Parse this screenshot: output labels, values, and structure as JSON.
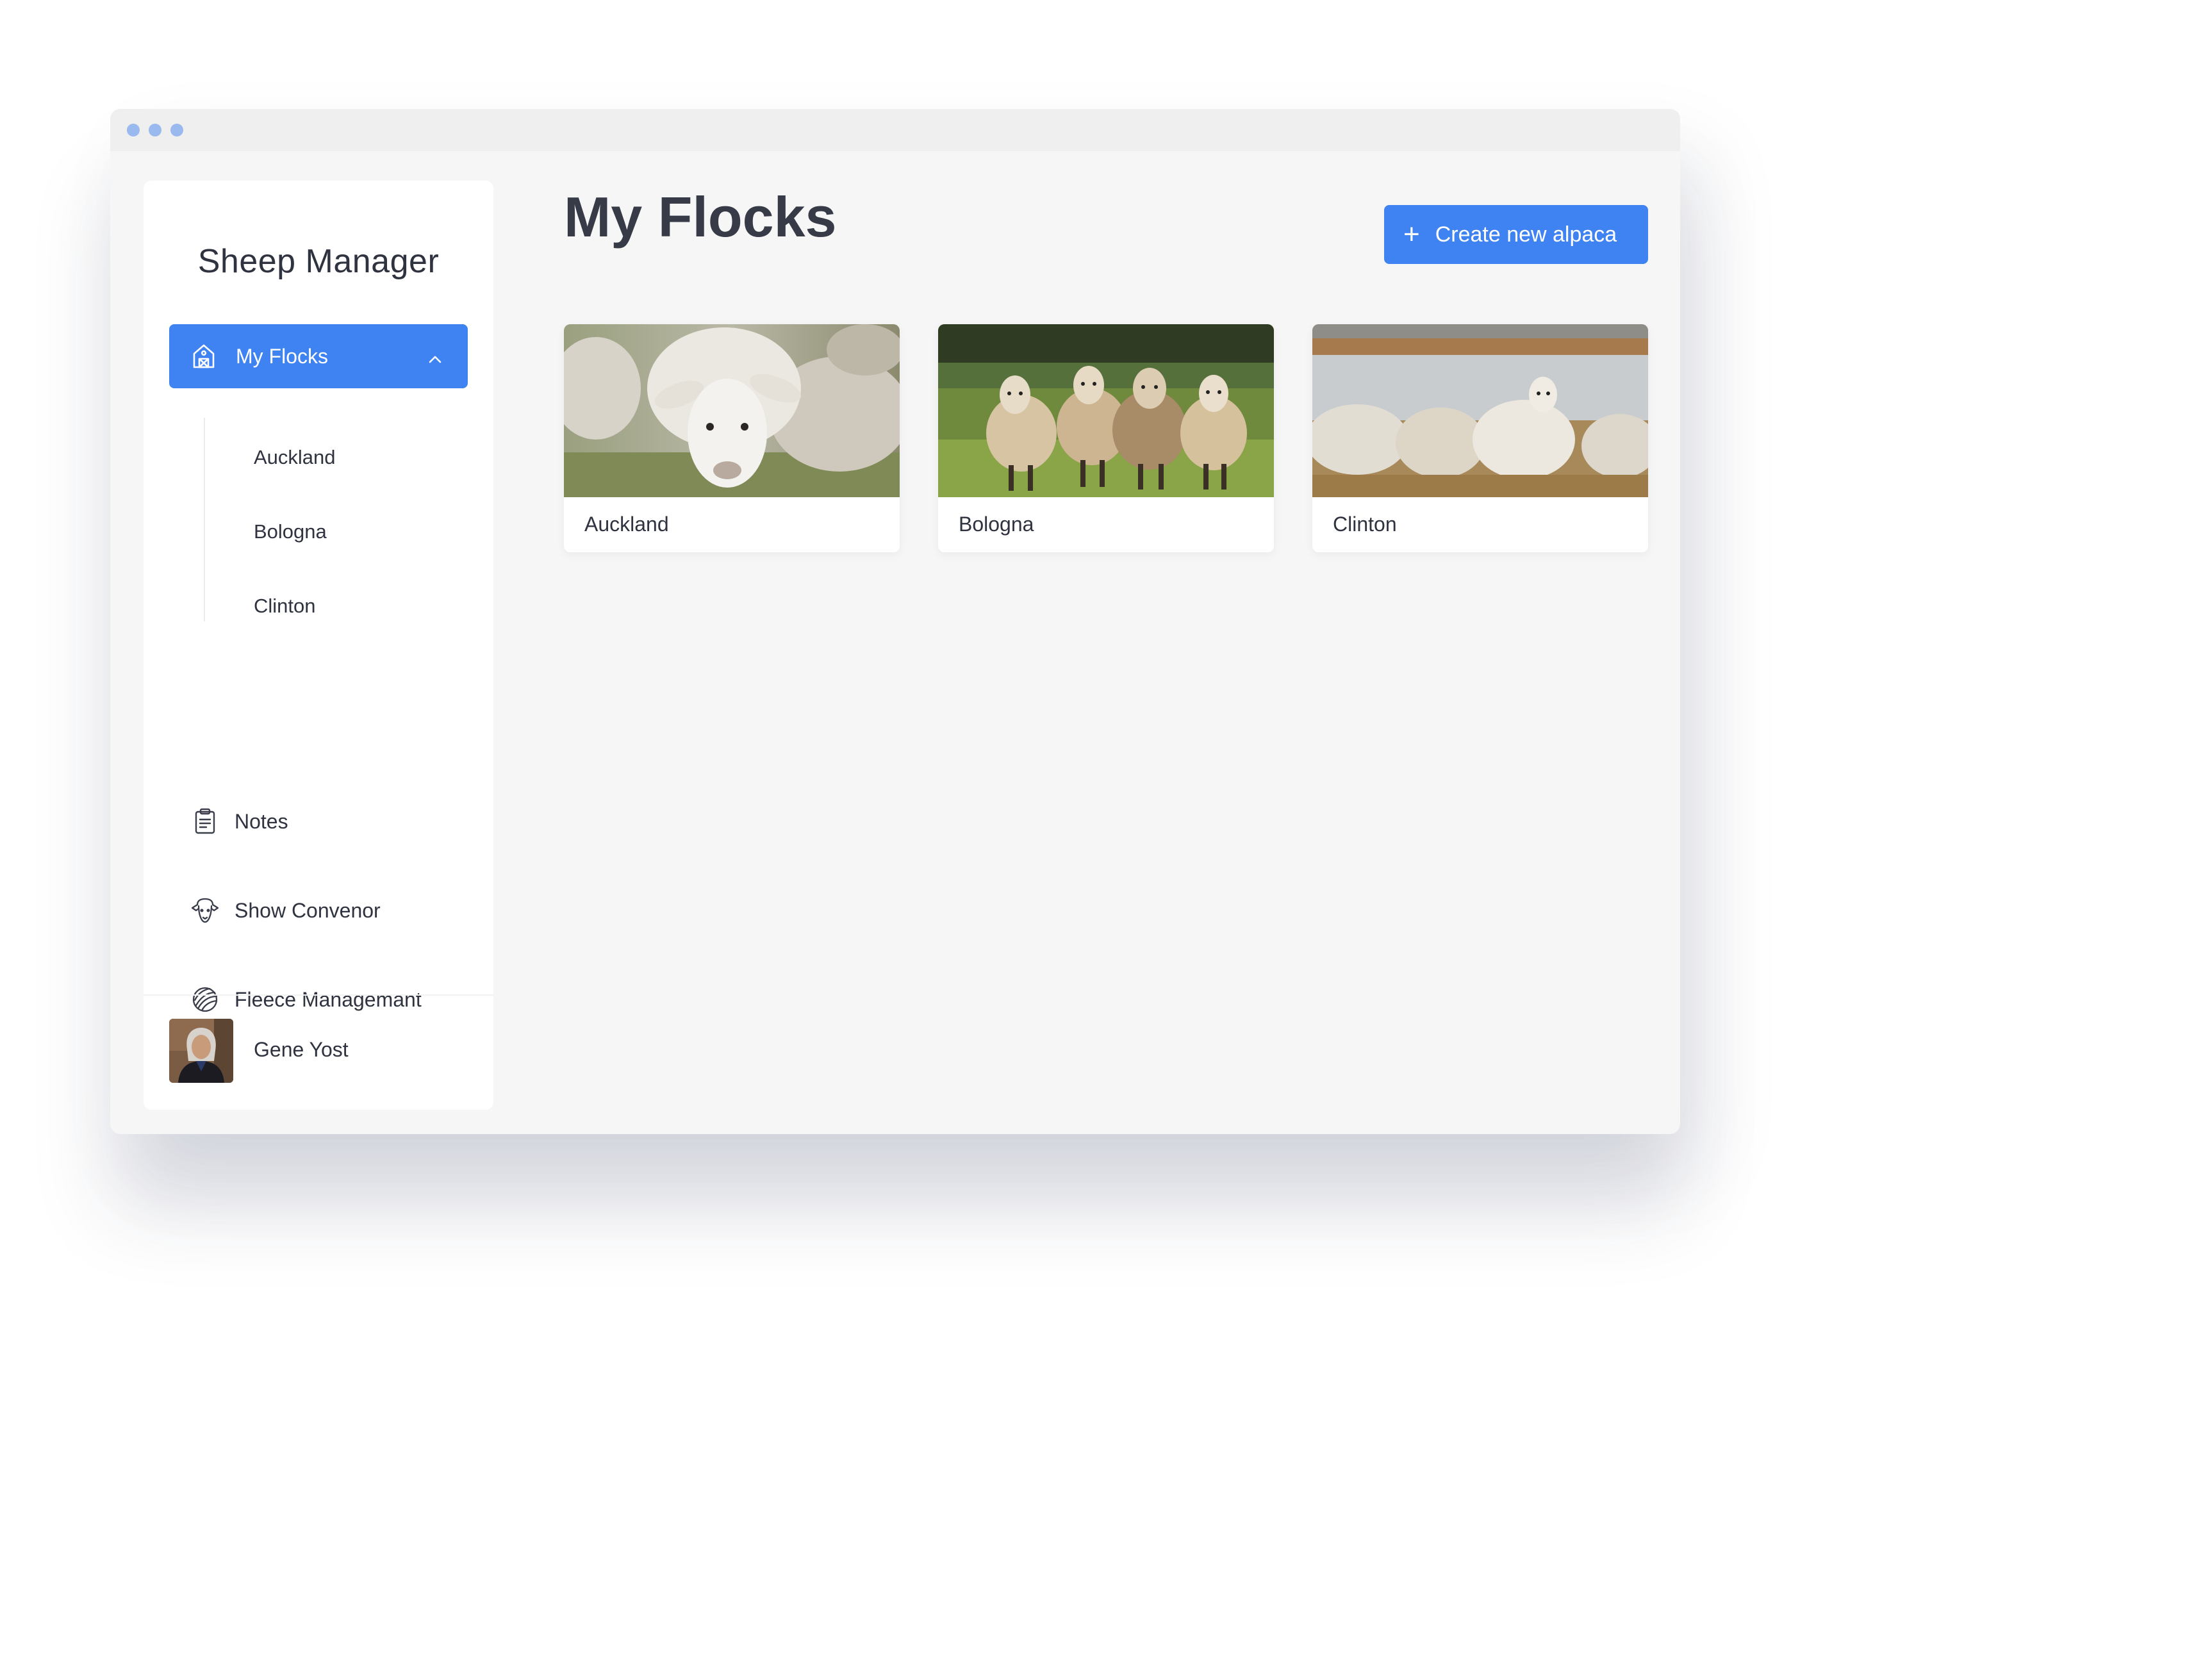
{
  "colors": {
    "accent": "#3f83f3",
    "window_bg": "#f6f6f6",
    "titlebar_bg": "#efefef",
    "text": "#2f3340",
    "title_text": "#373a47"
  },
  "app": {
    "brand": "Sheep Manager"
  },
  "sidebar": {
    "active_item": {
      "label": "My Flocks",
      "icon": "barn-icon",
      "expanded": true
    },
    "sub_items": [
      {
        "label": "Auckland"
      },
      {
        "label": "Bologna"
      },
      {
        "label": "Clinton"
      }
    ],
    "items": [
      {
        "label": "Notes",
        "icon": "notes-icon"
      },
      {
        "label": "Show Convenor",
        "icon": "sheep-face-icon"
      },
      {
        "label": "Fleece Managemant",
        "icon": "yarn-ball-icon"
      }
    ]
  },
  "profile": {
    "name": "Gene Yost"
  },
  "main": {
    "title": "My Flocks",
    "create_button": "Create new alpaca",
    "cards": [
      {
        "label": "Auckland"
      },
      {
        "label": "Bologna"
      },
      {
        "label": "Clinton"
      }
    ]
  }
}
